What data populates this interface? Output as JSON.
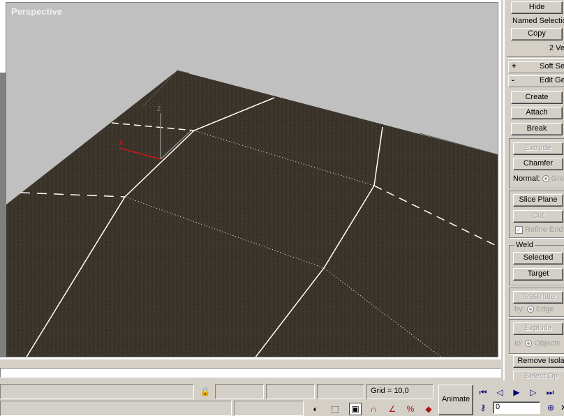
{
  "viewport": {
    "label": "Perspective"
  },
  "axes": {
    "z": "Z",
    "x": "X"
  },
  "panel": {
    "hide": "Hide",
    "named_selections": "Named Selection",
    "copy": "Copy",
    "selection_info": "2 Ve",
    "rollout_soft": {
      "sign": "+",
      "label": "Soft Se"
    },
    "rollout_edit": {
      "sign": "-",
      "label": "Edit Ge"
    },
    "create": "Create",
    "attach": "Attach",
    "break": "Break",
    "extrude": "Extrude",
    "chamfer": "Chamfer",
    "normal_label": "Normal:",
    "normal_option": "Gro",
    "slice_plane": "Slice Plane",
    "cut": "Cut",
    "refine_ends": "Refine End",
    "weld_label": "Weld",
    "selected": "Selected",
    "target": "Target",
    "tessellate": "Tessellate",
    "by_label": "by:",
    "by_option": "Edge",
    "explode": "Explode",
    "to_label": "to:",
    "to_option": "Objects",
    "remove_isolated": "Remove Isola",
    "select_open": "Select Op"
  },
  "status": {
    "grid": "Grid = 10,0",
    "animate": "Animate",
    "frame": "0"
  },
  "icons": [
    "lock-icon",
    "sphere-icon",
    "selection-region-icon",
    "box-icon",
    "snap-3d-icon",
    "angle-snap-icon",
    "percent-snap-icon",
    "spinner-snap-icon",
    "go-start-icon",
    "prev-frame-icon",
    "play-icon",
    "next-frame-icon",
    "go-end-icon",
    "key-icon",
    "zoom-time-icon"
  ],
  "colors": {
    "viewport_bg": "#c0c0c0",
    "ground": "#3a342b",
    "x_axis": "#d01818",
    "edge": "#ffffff"
  }
}
